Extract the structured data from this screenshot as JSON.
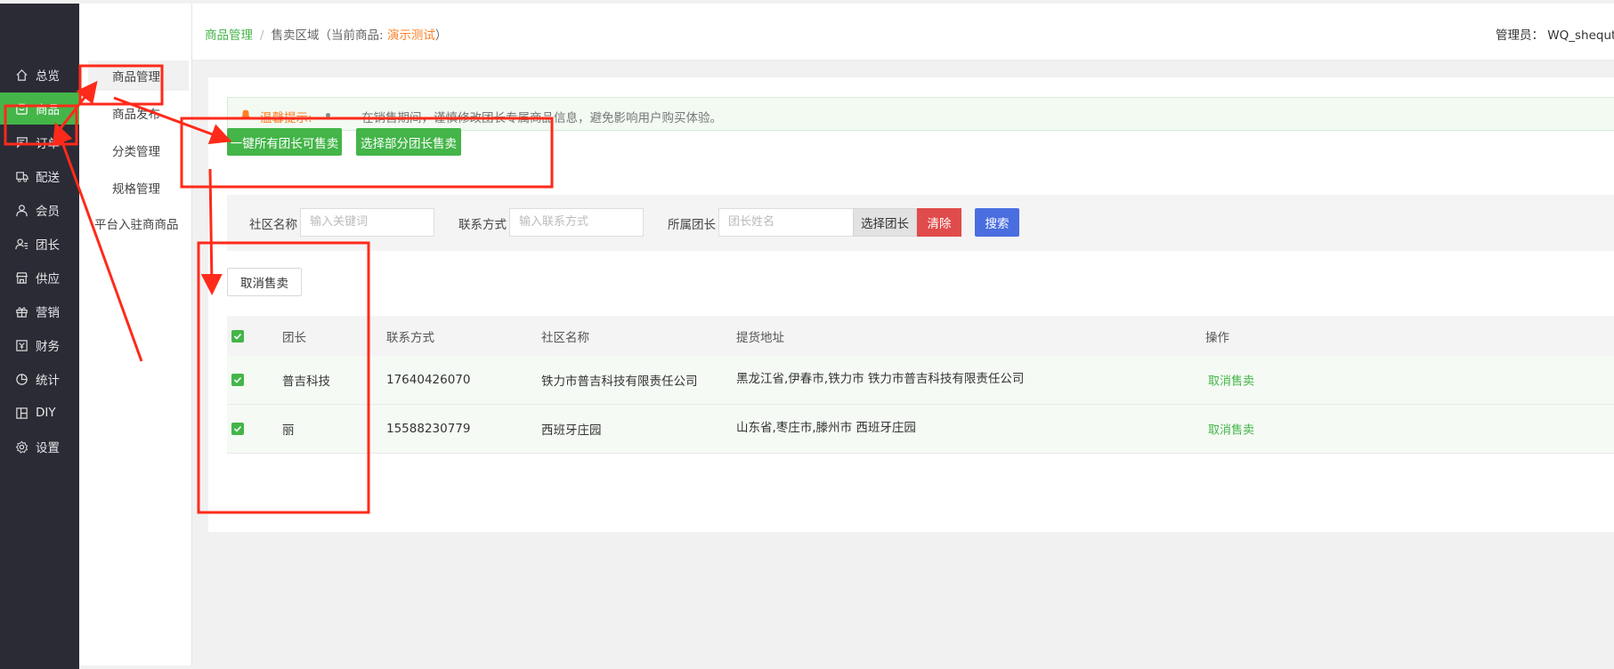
{
  "nav": {
    "items": [
      {
        "label": "总览",
        "icon": "home-icon"
      },
      {
        "label": "商品",
        "icon": "goods-box-icon"
      },
      {
        "label": "订单",
        "icon": "order-icon"
      },
      {
        "label": "配送",
        "icon": "delivery-icon"
      },
      {
        "label": "会员",
        "icon": "member-icon"
      },
      {
        "label": "团长",
        "icon": "leader-icon"
      },
      {
        "label": "供应",
        "icon": "supply-store-icon"
      },
      {
        "label": "营销",
        "icon": "gift-icon"
      },
      {
        "label": "财务",
        "icon": "finance-icon"
      },
      {
        "label": "统计",
        "icon": "pie-chart-icon"
      },
      {
        "label": "DIY",
        "icon": "layout-icon"
      },
      {
        "label": "设置",
        "icon": "gear-icon"
      }
    ],
    "active": "商品"
  },
  "submenu": {
    "items": [
      "商品管理",
      "商品发布",
      "分类管理",
      "规格管理",
      "平台入驻商商品"
    ]
  },
  "header": {
    "crumb_root": "商品管理",
    "crumb_sep": "/",
    "crumb_current_prefix": "售卖区域（当前商品:",
    "crumb_product": "演示测试",
    "crumb_current_suffix": "）",
    "admin": "管理员： WQ_shequtu"
  },
  "tip": {
    "title": "温馨提示:",
    "text": "在销售期间，谨慎修改团长专属商品信息，避免影响用户购买体验。"
  },
  "actions": {
    "all_leaders": "一键所有团长可售卖",
    "some_leaders": "选择部分团长售卖"
  },
  "filters": {
    "community_label": "社区名称",
    "community_placeholder": "输入关键词",
    "contact_label": "联系方式",
    "contact_placeholder": "输入联系方式",
    "leader_label": "所属团长",
    "leader_placeholder": "团长姓名",
    "select_leader": "选择团长",
    "clear": "清除",
    "search": "搜索"
  },
  "cancel_sale_button": "取消售卖",
  "table": {
    "headers": {
      "leader": "团长",
      "contact": "联系方式",
      "community": "社区名称",
      "address": "提货地址",
      "action": "操作"
    },
    "rows": [
      {
        "leader": "普吉科技",
        "contact": "17640426070",
        "community": "铁力市普吉科技有限责任公司",
        "address": "黑龙江省,伊春市,铁力市 铁力市普吉科技有限责任公司",
        "action": "取消售卖",
        "checked": true
      },
      {
        "leader": "丽",
        "contact": "15588230779",
        "community": "西班牙庄园",
        "address": "山东省,枣庄市,滕州市 西班牙庄园",
        "action": "取消售卖",
        "checked": true
      }
    ]
  },
  "colors": {
    "accent": "#44b549",
    "nav_bg": "#2b2b36",
    "danger": "#e04b4b",
    "primary": "#4a6ee0",
    "warning": "#ff7f24",
    "annotation": "#ff2a1a"
  }
}
